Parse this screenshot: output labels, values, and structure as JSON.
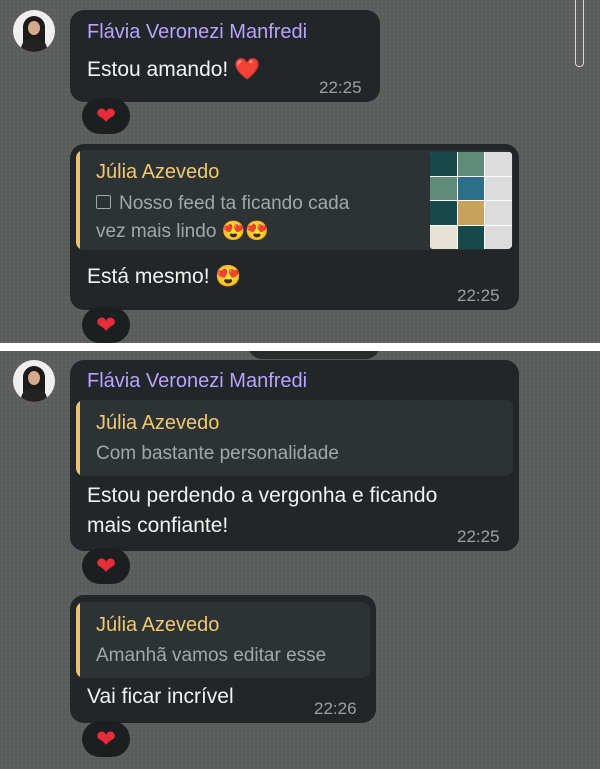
{
  "messages": [
    {
      "sender": "Flávia Veronezi Manfredi",
      "text": "Estou amando! ❤️",
      "time": "22:25",
      "reaction": "❤"
    },
    {
      "quote": {
        "name": "Júlia Azevedo",
        "line1": "Nosso feed ta ficando cada",
        "line2": "vez mais lindo 😍😍",
        "has_image": true,
        "image_icon": "image-icon"
      },
      "text": "Está mesmo! 😍",
      "time": "22:25",
      "reaction": "❤"
    },
    {
      "sender": "Flávia Veronezi Manfredi",
      "quote": {
        "name": "Júlia Azevedo",
        "line1": "Com bastante personalidade"
      },
      "line1": "Estou perdendo a vergonha e ficando",
      "line2": "mais confiante!",
      "time": "22:25",
      "reaction": "❤"
    },
    {
      "quote": {
        "name": "Júlia Azevedo",
        "line1": "Amanhã vamos editar esse"
      },
      "text": "Vai ficar incrível",
      "time": "22:26",
      "reaction": "❤"
    }
  ],
  "colors": {
    "background": "#5b5c5c",
    "bubble": "#222628",
    "sender_name": "#b6a4ff",
    "quote_accent": "#ecc36a",
    "time": "#9aa0a3",
    "heart": "#ea2c3a"
  }
}
